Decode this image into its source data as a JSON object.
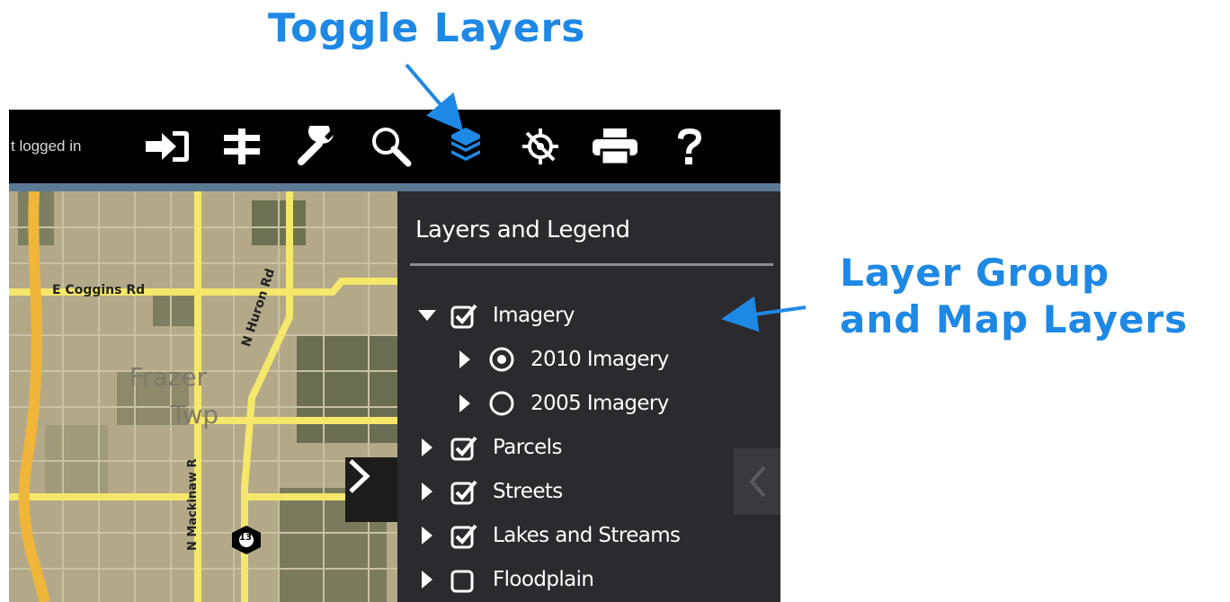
{
  "annotations": {
    "toggle_layers": "Toggle Layers",
    "layer_group_line1": "Layer Group",
    "layer_group_line2": "and Map Layers",
    "color": "#1e88e5"
  },
  "toolbar": {
    "status_text": "t logged in",
    "buttons": [
      {
        "icon": "sign-in-icon"
      },
      {
        "icon": "ruler-measure-icon"
      },
      {
        "icon": "wrench-tools-icon"
      },
      {
        "icon": "search-icon"
      },
      {
        "icon": "layers-icon",
        "active": true
      },
      {
        "icon": "gps-locate-icon"
      },
      {
        "icon": "printer-icon"
      },
      {
        "icon": "help-icon"
      }
    ],
    "active_color": "#1e88e5"
  },
  "map": {
    "road_labels": [
      "E Coggins Rd",
      "N Huron Rd",
      "N Mackinaw R"
    ],
    "place_label_line1": "Frazer",
    "place_label_line2": "Twp",
    "route_shield": "13"
  },
  "panel": {
    "title": "Layers and Legend",
    "layers": [
      {
        "label": "Imagery",
        "control": "checkbox",
        "checked": true,
        "expanded": true,
        "level": 0
      },
      {
        "label": "2010 Imagery",
        "control": "radio",
        "checked": true,
        "expanded": false,
        "level": 1
      },
      {
        "label": "2005 Imagery",
        "control": "radio",
        "checked": false,
        "expanded": false,
        "level": 1
      },
      {
        "label": "Parcels",
        "control": "checkbox",
        "checked": true,
        "expanded": false,
        "level": 0
      },
      {
        "label": "Streets",
        "control": "checkbox",
        "checked": true,
        "expanded": false,
        "level": 0
      },
      {
        "label": "Lakes and Streams",
        "control": "checkbox",
        "checked": true,
        "expanded": false,
        "level": 0
      },
      {
        "label": "Floodplain",
        "control": "checkbox",
        "checked": false,
        "expanded": false,
        "level": 0
      }
    ]
  }
}
